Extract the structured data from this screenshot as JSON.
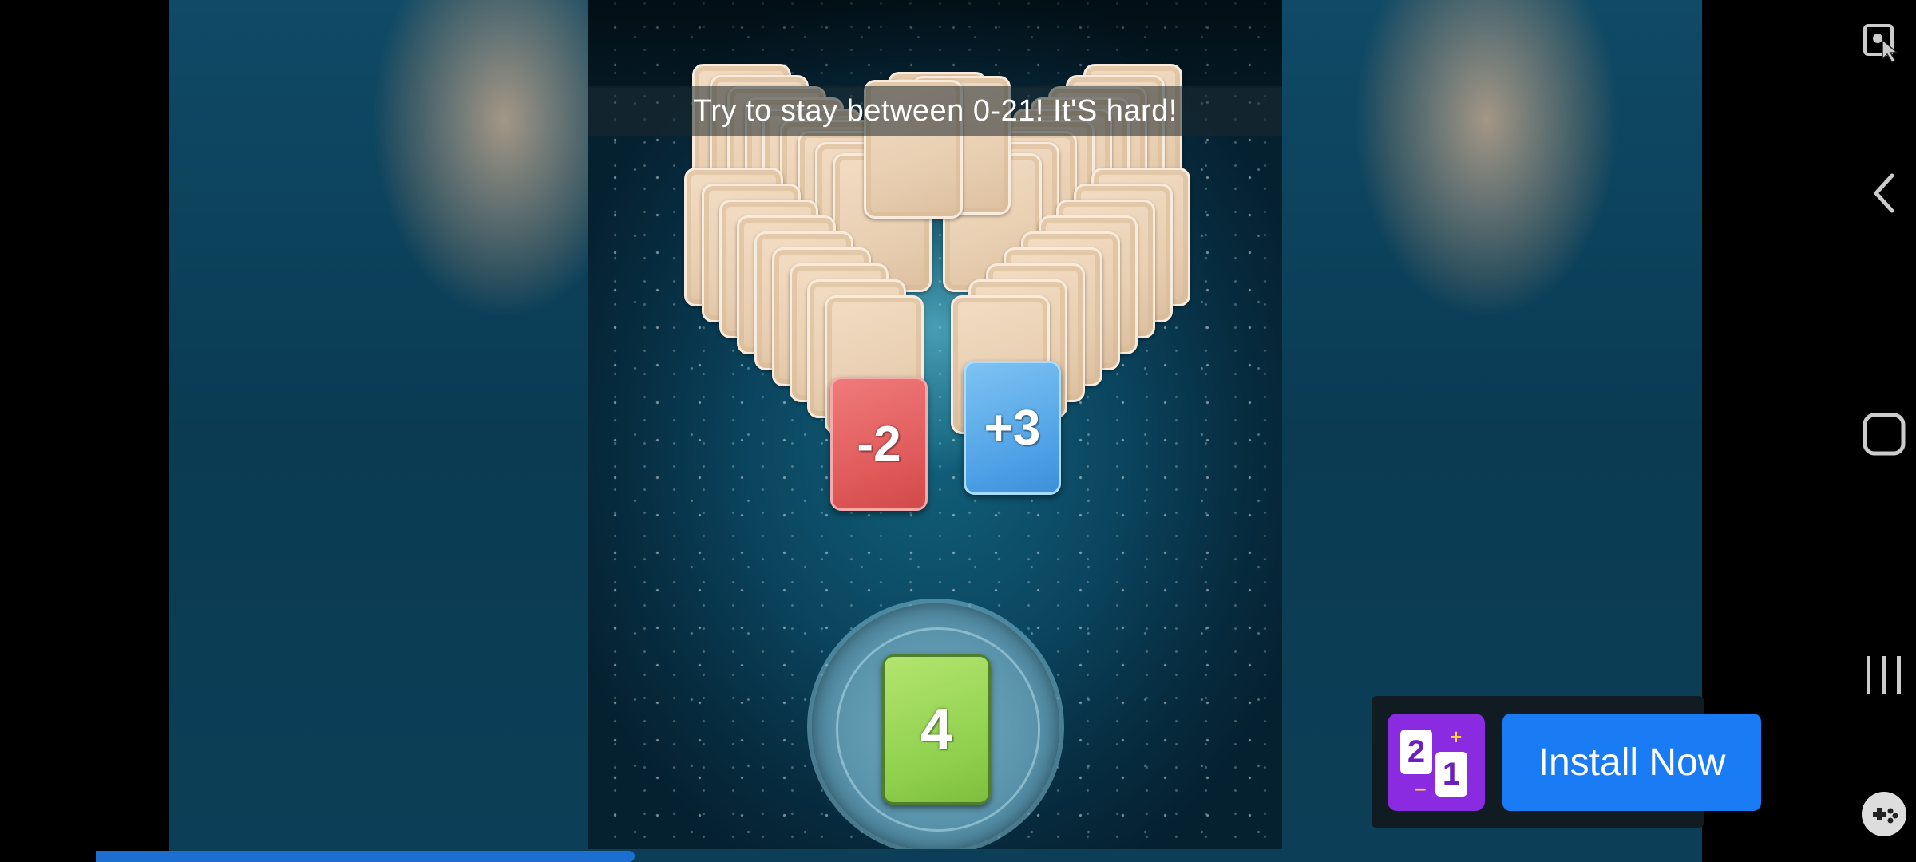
{
  "game": {
    "banner_text": "Try to stay between 0-21! It'S hard!",
    "cards": {
      "red": "-2",
      "blue": "+3",
      "current": "4"
    }
  },
  "ad": {
    "install_label": "Install Now",
    "app_icon": "2-1-plus-minus-app-icon"
  },
  "navigation": {
    "icons": [
      "screen-pointer-icon",
      "back-icon",
      "home-icon",
      "recent-apps-icon",
      "game-tools-icon"
    ]
  },
  "progress": {
    "value": 0.375
  },
  "colors": {
    "install_button": "#1a7cf5",
    "red_card": "#df5858",
    "blue_card": "#4ea1e6",
    "green_card": "#8fcf4d",
    "app_icon": "#8a2be2",
    "progress": "#1c6fd1"
  }
}
